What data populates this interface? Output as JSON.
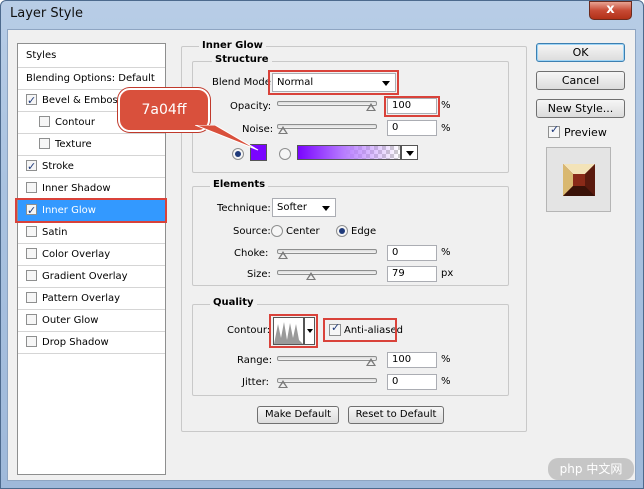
{
  "window": {
    "title": "Layer Style",
    "close_glyph": "x"
  },
  "sidebar": {
    "header": "Styles",
    "items": [
      {
        "label": "Blending Options: Default",
        "checkbox": false,
        "checked": false
      },
      {
        "label": "Bevel & Emboss",
        "checkbox": true,
        "checked": true
      },
      {
        "label": "Contour",
        "checkbox": true,
        "checked": false
      },
      {
        "label": "Texture",
        "checkbox": true,
        "checked": false
      },
      {
        "label": "Stroke",
        "checkbox": true,
        "checked": true
      },
      {
        "label": "Inner Shadow",
        "checkbox": true,
        "checked": false
      },
      {
        "label": "Inner Glow",
        "checkbox": true,
        "checked": true,
        "selected": true
      },
      {
        "label": "Satin",
        "checkbox": true,
        "checked": false
      },
      {
        "label": "Color Overlay",
        "checkbox": true,
        "checked": false
      },
      {
        "label": "Gradient Overlay",
        "checkbox": true,
        "checked": false
      },
      {
        "label": "Pattern Overlay",
        "checkbox": true,
        "checked": false
      },
      {
        "label": "Outer Glow",
        "checkbox": true,
        "checked": false
      },
      {
        "label": "Drop Shadow",
        "checkbox": true,
        "checked": false
      }
    ]
  },
  "panel": {
    "title": "Inner Glow",
    "structure": {
      "title": "Structure",
      "blend_mode_label": "Blend Mode:",
      "blend_mode_value": "Normal",
      "opacity_label": "Opacity:",
      "opacity_value": "100",
      "opacity_level": 1.0,
      "noise_label": "Noise:",
      "noise_value": "0",
      "noise_level": 0.0,
      "percent": "%",
      "color_swatch": "#7a04ff",
      "callout": "7a04ff"
    },
    "elements": {
      "title": "Elements",
      "technique_label": "Technique:",
      "technique_value": "Softer",
      "source_label": "Source:",
      "source_center": "Center",
      "source_edge": "Edge",
      "choke_label": "Choke:",
      "choke_value": "0",
      "choke_level": 0.0,
      "size_label": "Size:",
      "size_value": "79",
      "size_level": 0.32,
      "percent": "%",
      "px": "px"
    },
    "quality": {
      "title": "Quality",
      "contour_label": "Contour:",
      "anti_aliased_label": "Anti-aliased",
      "anti_aliased": true,
      "range_label": "Range:",
      "range_value": "100",
      "range_level": 1.0,
      "jitter_label": "Jitter:",
      "jitter_value": "0",
      "jitter_level": 0.0,
      "percent": "%"
    },
    "make_default": "Make Default",
    "reset_default": "Reset to Default"
  },
  "buttons": {
    "ok": "OK",
    "cancel": "Cancel",
    "new_style": "New Style...",
    "preview_label": "Preview",
    "preview_checked": true
  },
  "watermark": "php 中文网"
}
